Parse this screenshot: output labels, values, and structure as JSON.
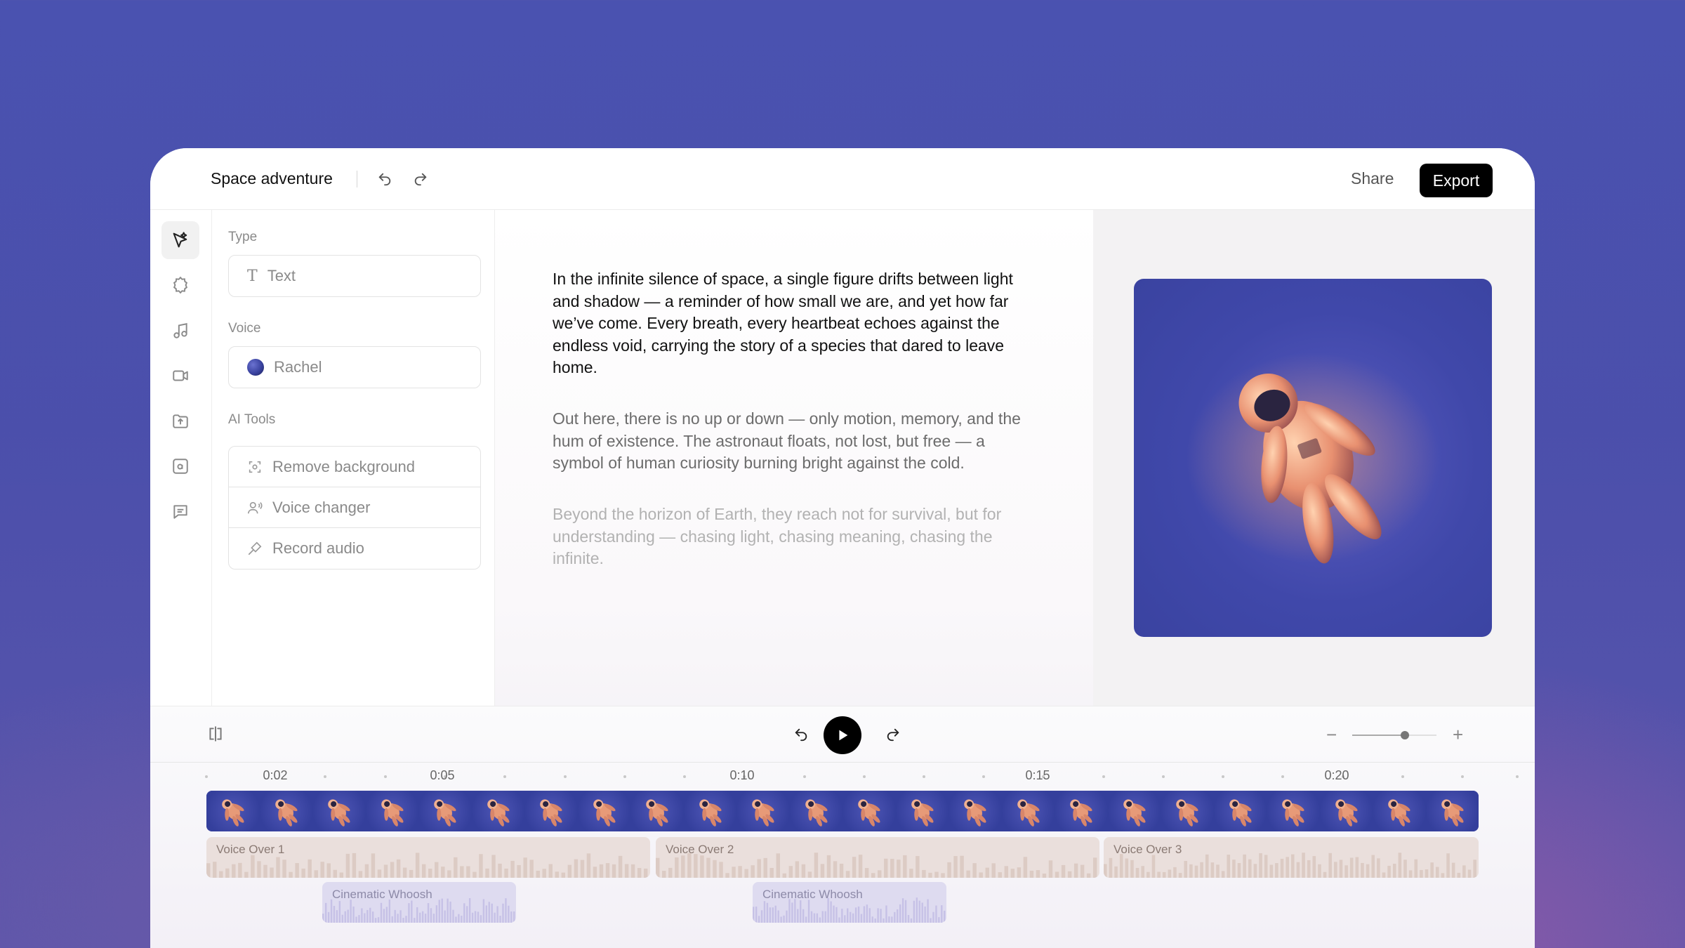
{
  "header": {
    "title": "Space adventure",
    "share_label": "Share",
    "export_label": "Export"
  },
  "rail": {
    "items": [
      "select-tool-icon",
      "settings-icon",
      "music-icon",
      "video-icon",
      "folder-upload-icon",
      "text-box-icon",
      "captions-icon"
    ]
  },
  "panel": {
    "type_label": "Type",
    "type_value": "Text",
    "voice_label": "Voice",
    "voice_value": "Rachel",
    "ai_tools_label": "AI Tools",
    "tools": [
      {
        "label": "Remove background",
        "icon": "remove-background-icon"
      },
      {
        "label": "Voice changer",
        "icon": "voice-changer-icon"
      },
      {
        "label": "Record audio",
        "icon": "microphone-icon"
      }
    ]
  },
  "script": {
    "paragraphs": [
      "In the infinite silence of space, a single figure drifts between light and shadow — a reminder of how small we are, and yet how far we’ve come. Every breath, every heartbeat echoes against the endless void, carrying the story of a species that dared to leave home.",
      "Out here, there is no up or down — only motion, memory, and the hum of existence. The astronaut floats, not lost, but free — a symbol of human curiosity burning bright against the cold.",
      "Beyond the horizon of Earth, they reach not for survival, but for understanding — chasing light, chasing meaning, chasing the infinite."
    ]
  },
  "timeline": {
    "ruler_labels": [
      "0:02",
      "0:05",
      "0:10",
      "0:15",
      "0:20"
    ],
    "voice_clips": [
      "Voice Over 1",
      "Voice Over 2",
      "Voice Over 3"
    ],
    "sfx_clips": [
      "Cinematic Whoosh",
      "Cinematic Whoosh"
    ],
    "zoom_level": 0.58
  },
  "colors": {
    "accent": "#000000",
    "video_track": "#3c47a8",
    "voice_clip": "#eadfdc",
    "sfx_clip": "#dedbf0"
  }
}
